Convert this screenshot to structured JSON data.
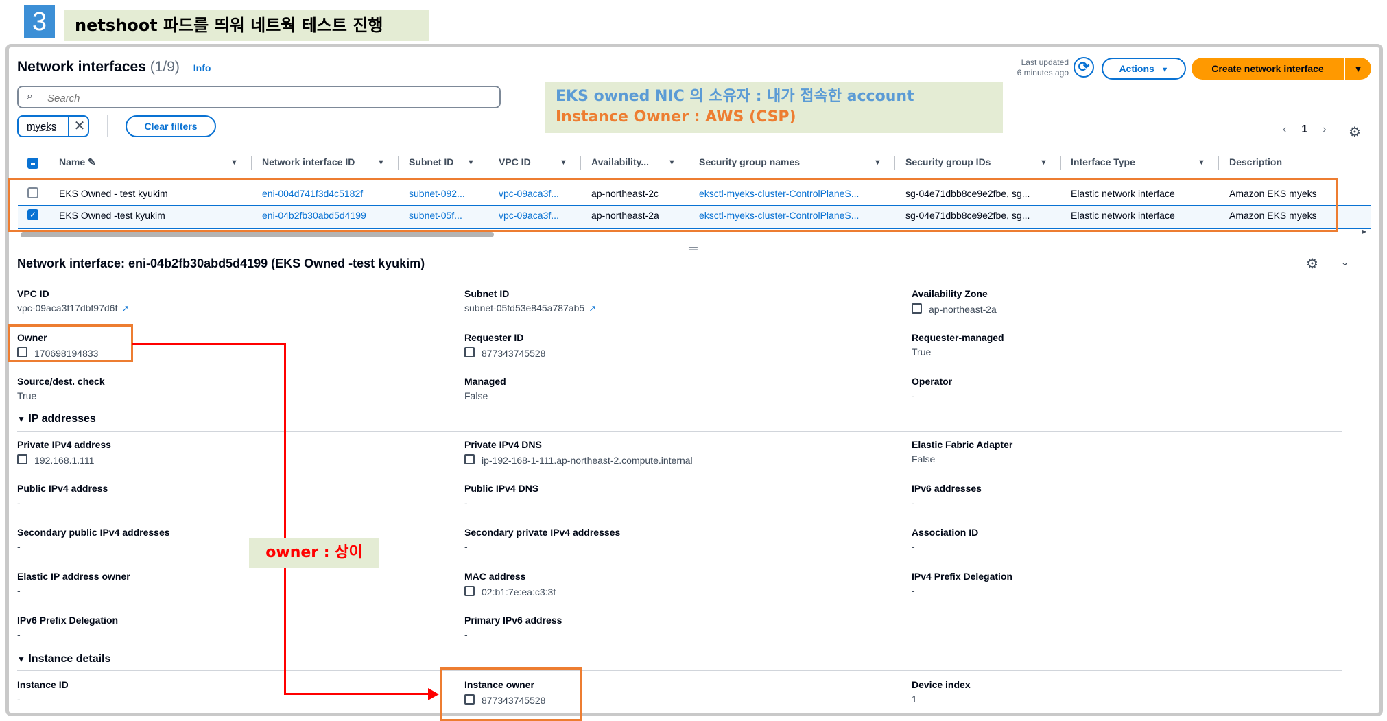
{
  "step": {
    "number": "3",
    "title": "netshoot 파드를 띄워 네트웍 테스트 진행"
  },
  "header": {
    "title": "Network interfaces",
    "count": "(1/9)",
    "info": "Info",
    "last_updated_line1": "Last updated",
    "last_updated_line2": "6 minutes ago",
    "actions_label": "Actions",
    "create_label": "Create network interface"
  },
  "search": {
    "placeholder": "Search"
  },
  "filter": {
    "token": "myeks",
    "clear_label": "Clear filters"
  },
  "annotation": {
    "line1": "EKS owned NIC 의 소유자 : 내가 접속한 account",
    "line2": "Instance Owner : AWS (CSP)",
    "owner_note": "owner : 상이"
  },
  "pagination": {
    "page": "1"
  },
  "table": {
    "columns": [
      "Name",
      "Network interface ID",
      "Subnet ID",
      "VPC ID",
      "Availability...",
      "Security group names",
      "Security group IDs",
      "Interface Type",
      "Description"
    ],
    "rows": [
      {
        "selected": false,
        "name": "EKS Owned - test kyukim",
        "eni": "eni-004d741f3d4c5182f",
        "subnet": "subnet-092...",
        "vpc": "vpc-09aca3f...",
        "az": "ap-northeast-2c",
        "sg_names": "eksctl-myeks-cluster-ControlPlaneS...",
        "sg_ids": "sg-04e71dbb8ce9e2fbe, sg...",
        "type": "Elastic network interface",
        "desc": "Amazon EKS myeks"
      },
      {
        "selected": true,
        "name": "EKS Owned -test kyukim",
        "eni": "eni-04b2fb30abd5d4199",
        "subnet": "subnet-05f...",
        "vpc": "vpc-09aca3f...",
        "az": "ap-northeast-2a",
        "sg_names": "eksctl-myeks-cluster-ControlPlaneS...",
        "sg_ids": "sg-04e71dbb8ce9e2fbe, sg...",
        "type": "Elastic network interface",
        "desc": "Amazon EKS myeks"
      }
    ]
  },
  "detail": {
    "title": "Network interface: eni-04b2fb30abd5d4199 (EKS Owned -test kyukim)",
    "vpc_id": {
      "label": "VPC ID",
      "value": "vpc-09aca3f17dbf97d6f"
    },
    "subnet_id": {
      "label": "Subnet ID",
      "value": "subnet-05fd53e845a787ab5"
    },
    "az": {
      "label": "Availability Zone",
      "value": "ap-northeast-2a"
    },
    "owner": {
      "label": "Owner",
      "value": "170698194833"
    },
    "requester_id": {
      "label": "Requester ID",
      "value": "877343745528"
    },
    "requester_managed": {
      "label": "Requester-managed",
      "value": "True"
    },
    "src_dest": {
      "label": "Source/dest. check",
      "value": "True"
    },
    "managed": {
      "label": "Managed",
      "value": "False"
    },
    "operator": {
      "label": "Operator",
      "value": "-"
    },
    "ip_section": "IP addresses",
    "private_ipv4": {
      "label": "Private IPv4 address",
      "value": "192.168.1.111"
    },
    "private_dns": {
      "label": "Private IPv4 DNS",
      "value": "ip-192-168-1-111.ap-northeast-2.compute.internal"
    },
    "efa": {
      "label": "Elastic Fabric Adapter",
      "value": "False"
    },
    "public_ipv4": {
      "label": "Public IPv4 address",
      "value": "-"
    },
    "public_dns": {
      "label": "Public IPv4 DNS",
      "value": "-"
    },
    "ipv6": {
      "label": "IPv6 addresses",
      "value": "-"
    },
    "sec_public": {
      "label": "Secondary public IPv4 addresses",
      "value": "-"
    },
    "sec_private": {
      "label": "Secondary private IPv4 addresses",
      "value": "-"
    },
    "assoc_id": {
      "label": "Association ID",
      "value": "-"
    },
    "eip_owner": {
      "label": "Elastic IP address owner",
      "value": "-"
    },
    "mac": {
      "label": "MAC address",
      "value": "02:b1:7e:ea:c3:3f"
    },
    "ipv4_prefix": {
      "label": "IPv4 Prefix Delegation",
      "value": "-"
    },
    "ipv6_prefix": {
      "label": "IPv6 Prefix Delegation",
      "value": "-"
    },
    "primary_ipv6": {
      "label": "Primary IPv6 address",
      "value": "-"
    },
    "instance_section": "Instance details",
    "instance_id": {
      "label": "Instance ID",
      "value": "-"
    },
    "instance_owner": {
      "label": "Instance owner",
      "value": "877343745528"
    },
    "device_index": {
      "label": "Device index",
      "value": "1"
    }
  }
}
